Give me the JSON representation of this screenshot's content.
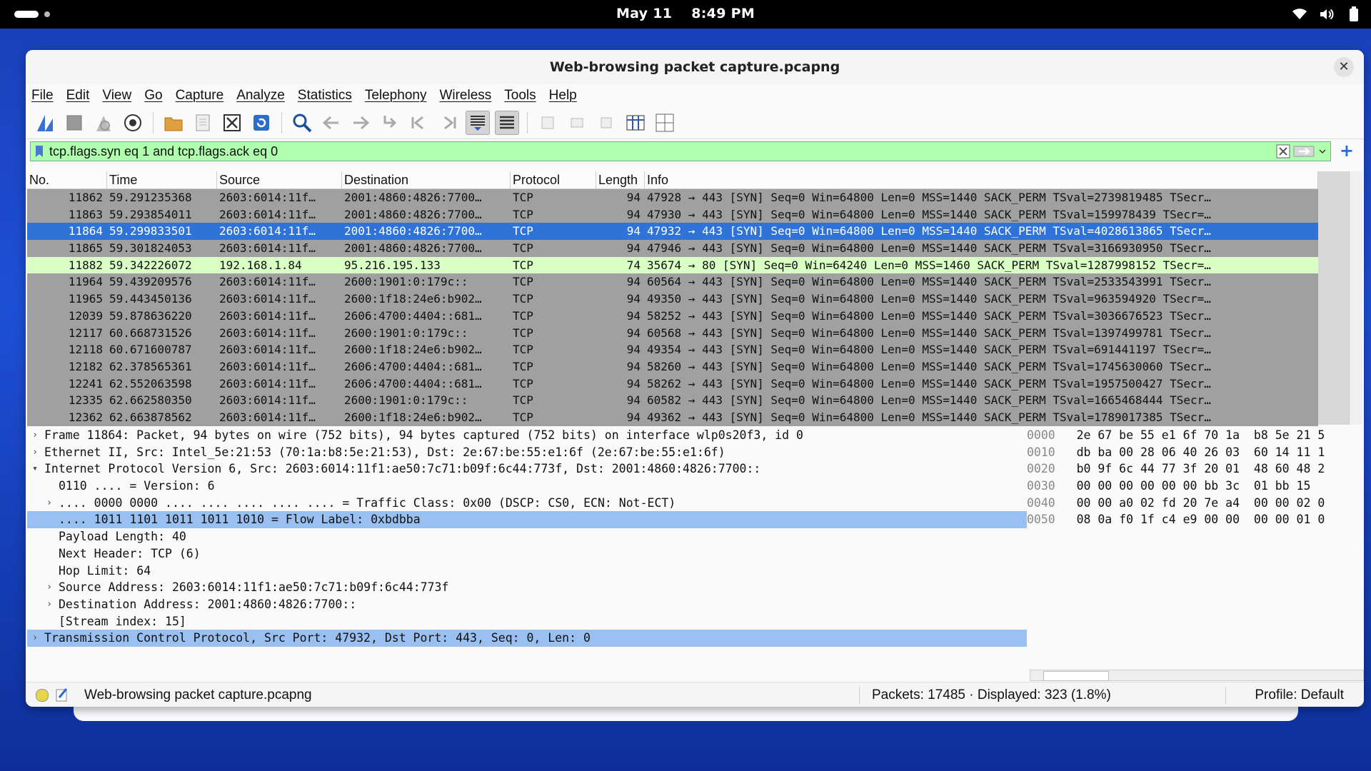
{
  "system": {
    "date": "May 11",
    "time": "8:49 PM"
  },
  "window": {
    "title": "Web-browsing packet capture.pcapng"
  },
  "menu": [
    "File",
    "Edit",
    "View",
    "Go",
    "Capture",
    "Analyze",
    "Statistics",
    "Telephony",
    "Wireless",
    "Tools",
    "Help"
  ],
  "filter": {
    "value": "tcp.flags.syn eq 1 and tcp.flags.ack eq 0"
  },
  "columns": {
    "no": "No.",
    "time": "Time",
    "source": "Source",
    "destination": "Destination",
    "protocol": "Protocol",
    "length": "Length",
    "info": "Info"
  },
  "packets": [
    {
      "no": "11862",
      "time": "59.291235368",
      "src": "2603:6014:11f…",
      "dst": "2001:4860:4826:7700…",
      "proto": "TCP",
      "len": "94",
      "info": "47928 → 443 [SYN] Seq=0 Win=64800 Len=0 MSS=1440 SACK_PERM TSval=2739819485 TSecr…",
      "state": "normal"
    },
    {
      "no": "11863",
      "time": "59.293854011",
      "src": "2603:6014:11f…",
      "dst": "2001:4860:4826:7700…",
      "proto": "TCP",
      "len": "94",
      "info": "47930 → 443 [SYN] Seq=0 Win=64800 Len=0 MSS=1440 SACK_PERM TSval=159978439 TSecr=…",
      "state": "normal"
    },
    {
      "no": "11864",
      "time": "59.299833501",
      "src": "2603:6014:11f…",
      "dst": "2001:4860:4826:7700…",
      "proto": "TCP",
      "len": "94",
      "info": "47932 → 443 [SYN] Seq=0 Win=64800 Len=0 MSS=1440 SACK_PERM TSval=4028613865 TSecr…",
      "state": "selected"
    },
    {
      "no": "11865",
      "time": "59.301824053",
      "src": "2603:6014:11f…",
      "dst": "2001:4860:4826:7700…",
      "proto": "TCP",
      "len": "94",
      "info": "47946 → 443 [SYN] Seq=0 Win=64800 Len=0 MSS=1440 SACK_PERM TSval=3166930950 TSecr…",
      "state": "normal"
    },
    {
      "no": "11882",
      "time": "59.342226072",
      "src": "192.168.1.84",
      "dst": "95.216.195.133",
      "proto": "TCP",
      "len": "74",
      "info": "35674 → 80 [SYN] Seq=0 Win=64240 Len=0 MSS=1460 SACK_PERM TSval=1287998152 TSecr=…",
      "state": "green"
    },
    {
      "no": "11964",
      "time": "59.439209576",
      "src": "2603:6014:11f…",
      "dst": "2600:1901:0:179c::",
      "proto": "TCP",
      "len": "94",
      "info": "60564 → 443 [SYN] Seq=0 Win=64800 Len=0 MSS=1440 SACK_PERM TSval=2533543991 TSecr…",
      "state": "normal"
    },
    {
      "no": "11965",
      "time": "59.443450136",
      "src": "2603:6014:11f…",
      "dst": "2600:1f18:24e6:b902…",
      "proto": "TCP",
      "len": "94",
      "info": "49350 → 443 [SYN] Seq=0 Win=64800 Len=0 MSS=1440 SACK_PERM TSval=963594920 TSecr=…",
      "state": "normal"
    },
    {
      "no": "12039",
      "time": "59.878636220",
      "src": "2603:6014:11f…",
      "dst": "2606:4700:4404::681…",
      "proto": "TCP",
      "len": "94",
      "info": "58252 → 443 [SYN] Seq=0 Win=64800 Len=0 MSS=1440 SACK_PERM TSval=3036676523 TSecr…",
      "state": "normal"
    },
    {
      "no": "12117",
      "time": "60.668731526",
      "src": "2603:6014:11f…",
      "dst": "2600:1901:0:179c::",
      "proto": "TCP",
      "len": "94",
      "info": "60568 → 443 [SYN] Seq=0 Win=64800 Len=0 MSS=1440 SACK_PERM TSval=1397499781 TSecr…",
      "state": "normal"
    },
    {
      "no": "12118",
      "time": "60.671600787",
      "src": "2603:6014:11f…",
      "dst": "2600:1f18:24e6:b902…",
      "proto": "TCP",
      "len": "94",
      "info": "49354 → 443 [SYN] Seq=0 Win=64800 Len=0 MSS=1440 SACK_PERM TSval=691441197 TSecr=…",
      "state": "normal"
    },
    {
      "no": "12182",
      "time": "62.378565361",
      "src": "2603:6014:11f…",
      "dst": "2606:4700:4404::681…",
      "proto": "TCP",
      "len": "94",
      "info": "58260 → 443 [SYN] Seq=0 Win=64800 Len=0 MSS=1440 SACK_PERM TSval=1745630060 TSecr…",
      "state": "normal"
    },
    {
      "no": "12241",
      "time": "62.552063598",
      "src": "2603:6014:11f…",
      "dst": "2606:4700:4404::681…",
      "proto": "TCP",
      "len": "94",
      "info": "58262 → 443 [SYN] Seq=0 Win=64800 Len=0 MSS=1440 SACK_PERM TSval=1957500427 TSecr…",
      "state": "normal"
    },
    {
      "no": "12335",
      "time": "62.662580350",
      "src": "2603:6014:11f…",
      "dst": "2600:1901:0:179c::",
      "proto": "TCP",
      "len": "94",
      "info": "60582 → 443 [SYN] Seq=0 Win=64800 Len=0 MSS=1440 SACK_PERM TSval=1665468444 TSecr…",
      "state": "normal"
    },
    {
      "no": "12362",
      "time": "62.663878562",
      "src": "2603:6014:11f…",
      "dst": "2600:1f18:24e6:b902…",
      "proto": "TCP",
      "len": "94",
      "info": "49362 → 443 [SYN] Seq=0 Win=64800 Len=0 MSS=1440 SACK_PERM TSval=1789017385 TSecr…",
      "state": "normal"
    }
  ],
  "details": [
    {
      "text": "Frame 11864: Packet, 94 bytes on wire (752 bits), 94 bytes captured (752 bits) on interface wlp0s20f3, id 0",
      "level": 0,
      "arrow": "collapsed",
      "hl": false
    },
    {
      "text": "Ethernet II, Src: Intel_5e:21:53 (70:1a:b8:5e:21:53), Dst: 2e:67:be:55:e1:6f (2e:67:be:55:e1:6f)",
      "level": 0,
      "arrow": "collapsed",
      "hl": false
    },
    {
      "text": "Internet Protocol Version 6, Src: 2603:6014:11f1:ae50:7c71:b09f:6c44:773f, Dst: 2001:4860:4826:7700::",
      "level": 0,
      "arrow": "expanded",
      "hl": false
    },
    {
      "text": "0110 .... = Version: 6",
      "level": 1,
      "arrow": "none",
      "hl": false
    },
    {
      "text": ".... 0000 0000 .... .... .... .... .... = Traffic Class: 0x00 (DSCP: CS0, ECN: Not-ECT)",
      "level": 1,
      "arrow": "collapsed",
      "hl": false
    },
    {
      "text": ".... 1011 1101 1011 1011 1010 = Flow Label: 0xbdbba",
      "level": 1,
      "arrow": "none",
      "hl": true
    },
    {
      "text": "Payload Length: 40",
      "level": 1,
      "arrow": "none",
      "hl": false
    },
    {
      "text": "Next Header: TCP (6)",
      "level": 1,
      "arrow": "none",
      "hl": false
    },
    {
      "text": "Hop Limit: 64",
      "level": 1,
      "arrow": "none",
      "hl": false
    },
    {
      "text": "Source Address: 2603:6014:11f1:ae50:7c71:b09f:6c44:773f",
      "level": 1,
      "arrow": "collapsed",
      "hl": false
    },
    {
      "text": "Destination Address: 2001:4860:4826:7700::",
      "level": 1,
      "arrow": "collapsed",
      "hl": false
    },
    {
      "text": "[Stream index: 15]",
      "level": 1,
      "arrow": "none",
      "hl": false
    },
    {
      "text": "Transmission Control Protocol, Src Port: 47932, Dst Port: 443, Seq: 0, Len: 0",
      "level": 0,
      "arrow": "collapsed",
      "hl": true
    }
  ],
  "hex": [
    {
      "off": "0000",
      "bytes": "2e 67 be 55 e1 6f 70 1a  b8 5e 21 5"
    },
    {
      "off": "0010",
      "bytes": "db ba 00 28 06 40 26 03  60 14 11 1"
    },
    {
      "off": "0020",
      "bytes": "b0 9f 6c 44 77 3f 20 01  48 60 48 2"
    },
    {
      "off": "0030",
      "bytes": "00 00 00 00 00 00 bb 3c  01 bb 15 "
    },
    {
      "off": "0040",
      "bytes": "00 00 a0 02 fd 20 7e a4  00 00 02 0"
    },
    {
      "off": "0050",
      "bytes": "08 0a f0 1f c4 e9 00 00  00 00 01 0"
    }
  ],
  "status": {
    "file": "Web-browsing packet capture.pcapng",
    "packets": "Packets: 17485 · Displayed: 323 (1.8%)",
    "profile": "Profile: Default"
  }
}
